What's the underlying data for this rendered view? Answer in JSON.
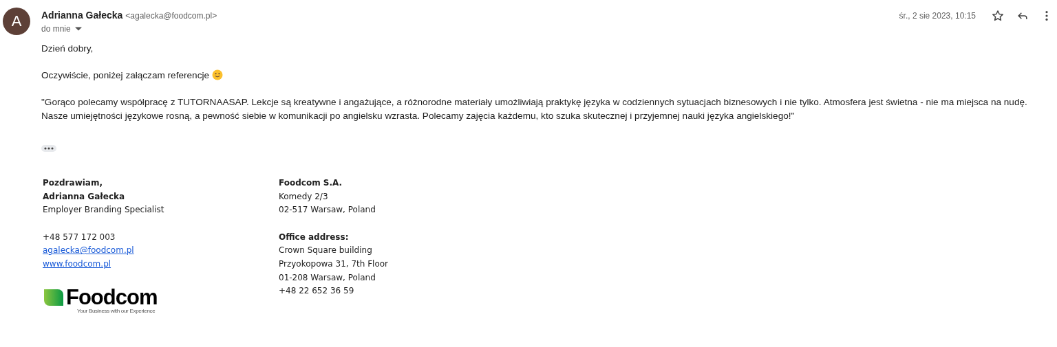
{
  "sender": {
    "initial": "A",
    "name": "Adrianna Gałecka",
    "email": "<agalecka@foodcom.pl>",
    "recipient": "do mnie"
  },
  "date": "śr., 2 sie 2023, 10:15",
  "starred": false,
  "body": [
    {
      "kind": "text",
      "text": "Dzień dobry,"
    },
    {
      "kind": "emoji",
      "text": "Oczywiście, poniżej załączam referencje"
    },
    {
      "kind": "text",
      "text": "\"Gorąco polecamy współpracę z TUTORNAASAP. Lekcje są kreatywne i angażujące, a różnorodne materiały umożliwiają praktykę języka w codziennych sytuacjach biznesowych i nie tylko. Atmosfera jest świetna - nie ma miejsca na nudę. Nasze umiejętności językowe rosną, a pewność siebie w komunikacji po angielsku wzrasta. Polecamy zajęcia każdemu, kto szuka skutecznej i przyjemnej nauki języka angielskiego!\""
    }
  ],
  "signature": {
    "columns": [
      [
        [
          {
            "kind": "bold",
            "text": "Pozdrawiam,"
          },
          {
            "kind": "bold",
            "text": "Adrianna Gałecka"
          },
          {
            "kind": "text",
            "text": "Employer Branding Specialist"
          }
        ],
        [
          {
            "kind": "text",
            "text": "+48 577 172 003"
          },
          {
            "kind": "link",
            "text": "agalecka@foodcom.pl"
          },
          {
            "kind": "link",
            "text": "www.foodcom.pl"
          }
        ]
      ],
      [
        [
          {
            "kind": "bold",
            "text": "Foodcom S.A."
          },
          {
            "kind": "text",
            "text": "Komedy 2/3"
          },
          {
            "kind": "text",
            "text": "02-517 Warsaw, Poland"
          }
        ],
        [
          {
            "kind": "bold",
            "text": "Office address:"
          },
          {
            "kind": "text",
            "text": "Crown Square building"
          },
          {
            "kind": "text",
            "text": "Przyokopowa 31, 7th Floor"
          },
          {
            "kind": "text",
            "text": "01-208 Warsaw, Poland"
          },
          {
            "kind": "text",
            "text": "+48 22 652 36 59"
          }
        ]
      ]
    ]
  },
  "logo": {
    "wordmark": "Foodcom",
    "tagline": "Your Business with our Experience"
  }
}
